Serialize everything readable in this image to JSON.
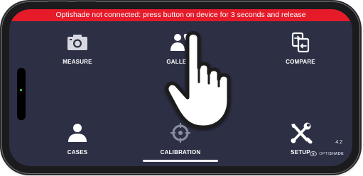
{
  "banner": {
    "text": "Optishade not connected: press button on device for 3 seconds and release",
    "color": "#e51b2a"
  },
  "menu": {
    "measure": {
      "label": "MEASURE",
      "icon": "camera-icon"
    },
    "gallery": {
      "label": "GALLERY",
      "icon": "gallery-person-tooth-icon"
    },
    "compare": {
      "label": "COMPARE",
      "icon": "compare-documents-icon"
    },
    "cases": {
      "label": "CASES",
      "icon": "person-icon"
    },
    "calibration": {
      "label": "CALIBRATION",
      "icon": "crosshair-icon"
    },
    "setup": {
      "label": "SETUP",
      "icon": "tools-icon"
    }
  },
  "footer": {
    "version": "4.2",
    "brand_light": "OPTI",
    "brand_bold": "SHADE"
  },
  "overlay": {
    "icon": "pointing-hand-icon"
  },
  "theme": {
    "background": "#2d2f45",
    "text": "#ffffff"
  }
}
